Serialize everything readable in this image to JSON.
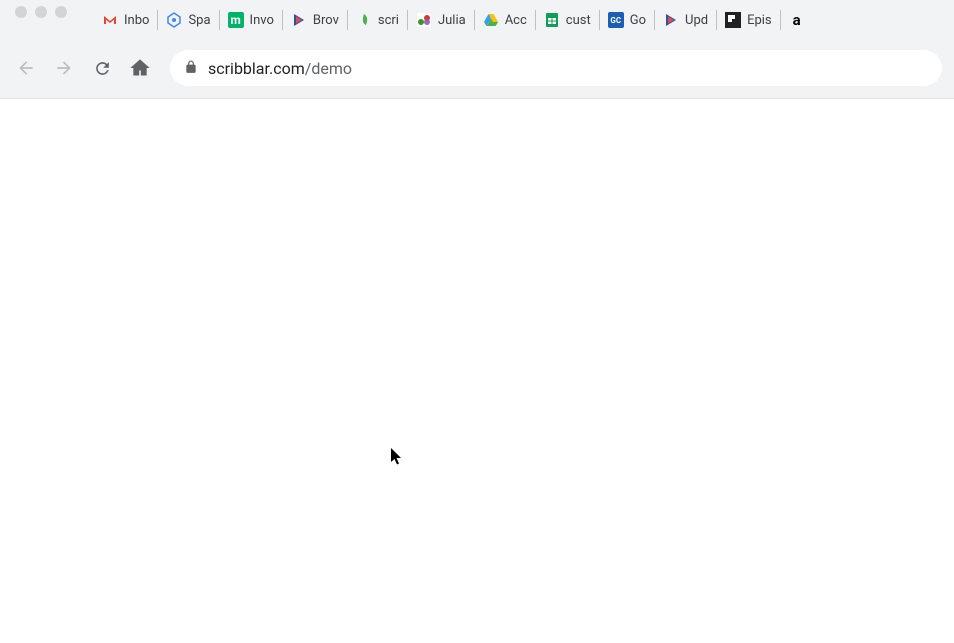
{
  "bookmarks": [
    {
      "label": "Inbo",
      "icon": "gmail"
    },
    {
      "label": "Spa",
      "icon": "blue-hex"
    },
    {
      "label": "Invo",
      "icon": "m-green"
    },
    {
      "label": "Brov",
      "icon": "triangle"
    },
    {
      "label": "scri",
      "icon": "leaf"
    },
    {
      "label": "Julia",
      "icon": "julia"
    },
    {
      "label": "Acc",
      "icon": "drive"
    },
    {
      "label": "cust",
      "icon": "sheets"
    },
    {
      "label": "Go",
      "icon": "gc"
    },
    {
      "label": "Upd",
      "icon": "triangle"
    },
    {
      "label": "Epis",
      "icon": "flip"
    },
    {
      "label": "",
      "icon": "amazon"
    }
  ],
  "url": {
    "domain": "scribblar.com",
    "path": "/demo"
  }
}
